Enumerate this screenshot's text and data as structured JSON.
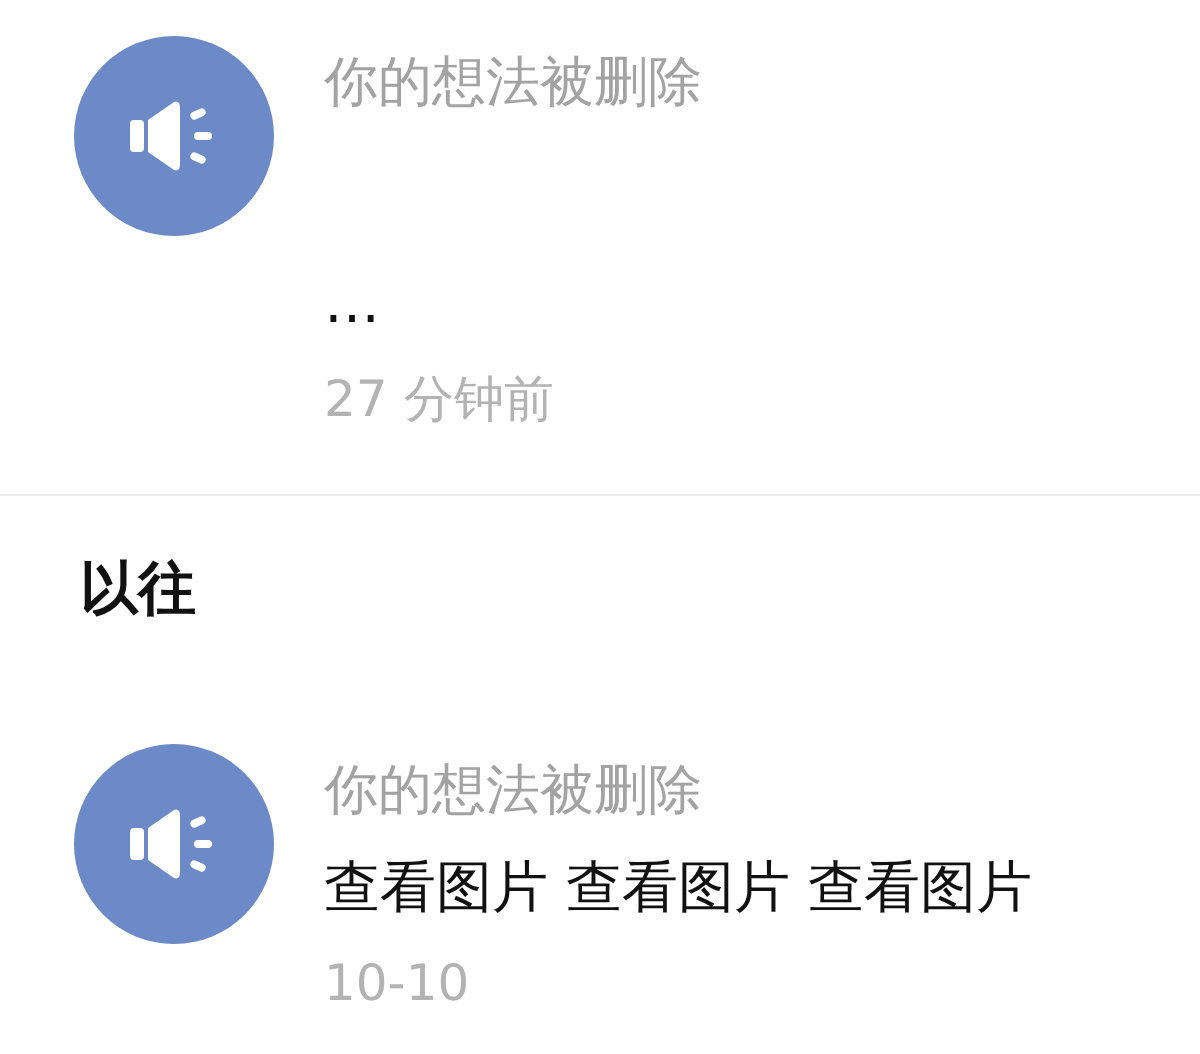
{
  "recent": [
    {
      "title": "你的想法被删除",
      "body": "…",
      "time": "27 分钟前"
    }
  ],
  "section": {
    "heading": "以往"
  },
  "earlier": [
    {
      "title": "你的想法被删除",
      "body": "查看图片 查看图片 查看图片",
      "time": "10-10"
    }
  ]
}
